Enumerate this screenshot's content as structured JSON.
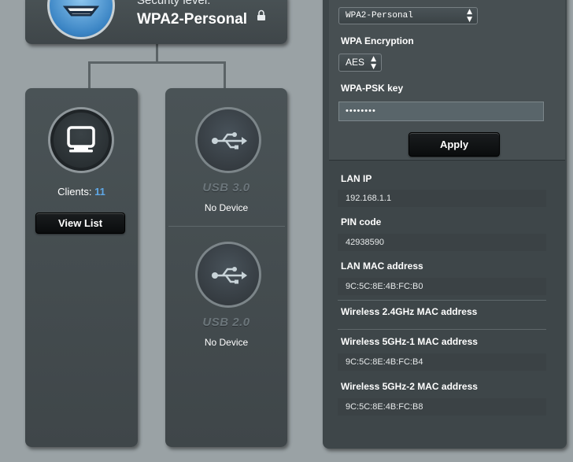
{
  "security": {
    "label": "Security level:",
    "value": "WPA2-Personal",
    "lock_icon": "lock-icon"
  },
  "clients": {
    "label": "Clients:",
    "count": "11",
    "button": "View List",
    "icon": "monitor-icon",
    "count_color": "#5fa8e6"
  },
  "usb": [
    {
      "label": "USB 3.0",
      "status": "No Device",
      "icon": "usb-icon"
    },
    {
      "label": "USB 2.0",
      "status": "No Device",
      "icon": "usb-icon"
    }
  ],
  "wireless": {
    "auth_select": "WPA2-Personal",
    "encryption_label": "WPA Encryption",
    "encryption_value": "AES",
    "psk_label": "WPA-PSK key",
    "psk_value": "••••••••",
    "apply_button": "Apply"
  },
  "info": [
    {
      "label": "LAN IP",
      "value": "192.168.1.1"
    },
    {
      "label": "PIN code",
      "value": "42938590"
    },
    {
      "label": "LAN MAC address",
      "value": "9C:5C:8E:4B:FC:B0"
    },
    {
      "label": "Wireless 2.4GHz MAC address",
      "value": ""
    },
    {
      "label": "Wireless 5GHz-1 MAC address",
      "value": "9C:5C:8E:4B:FC:B4"
    },
    {
      "label": "Wireless 5GHz-2 MAC address",
      "value": "9C:5C:8E:4B:FC:B8"
    }
  ]
}
